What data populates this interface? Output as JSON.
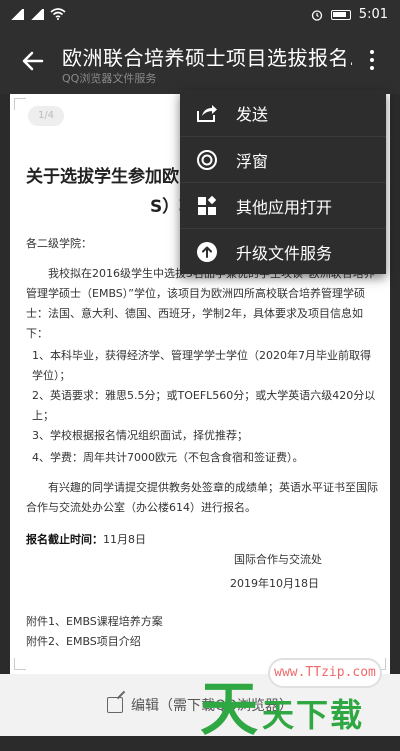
{
  "status_bar": {
    "time": "5:01"
  },
  "app_bar": {
    "title": "欧洲联合培养硕士项目选拔报名...",
    "subtitle": "QQ浏览器文件服务"
  },
  "document": {
    "page_badge": "1/4",
    "title_line1": "关于选拔学生参加欧",
    "title_line2": "S）项",
    "salutation": "各二级学院：",
    "para1": "我校拟在2016级学生中选拔5名品学兼优的学生攻读“欧洲联合培养管理学硕士（EMBS）”学位，该项目为欧洲四所高校联合培养管理学硕士：法国、意大利、德国、西班牙，学制2年，具体要求及项目信息如下：",
    "item1": "1、本科毕业，获得经济学、管理学学士学位（2020年7月毕业前取得学位）；",
    "item2": "2、英语要求：雅思5.5分；或TOEFL560分；或大学英语六级420分以上；",
    "item3": "3、学校根据报名情况组织面试，择优推荐；",
    "item4": "4、学费：周年共计7000欧元（不包含食宿和签证费）。",
    "para2": "有兴趣的同学请提交提供教务处签章的成绩单；英语水平证书至国际合作与交流处办公室（办公楼614）进行报名。",
    "deadline_label": "报名截止时间：",
    "deadline_value": "11月8日",
    "signature_org": "国际合作与交流处",
    "signature_date": "2019年10月18日",
    "attach1": "附件1、EMBS课程培养方案",
    "attach2": "附件2、EMBS项目介绍"
  },
  "bottom": {
    "edit_label": "编辑（需下载QQ浏览器）"
  },
  "menu": {
    "items": [
      {
        "label": "发送",
        "icon": "share-icon"
      },
      {
        "label": "浮窗",
        "icon": "float-window-icon"
      },
      {
        "label": "其他应用打开",
        "icon": "apps-icon"
      },
      {
        "label": "升级文件服务",
        "icon": "upgrade-icon"
      }
    ]
  },
  "watermark": {
    "url": "www.TTzip.com",
    "big_char": "天",
    "text": "天下载"
  }
}
